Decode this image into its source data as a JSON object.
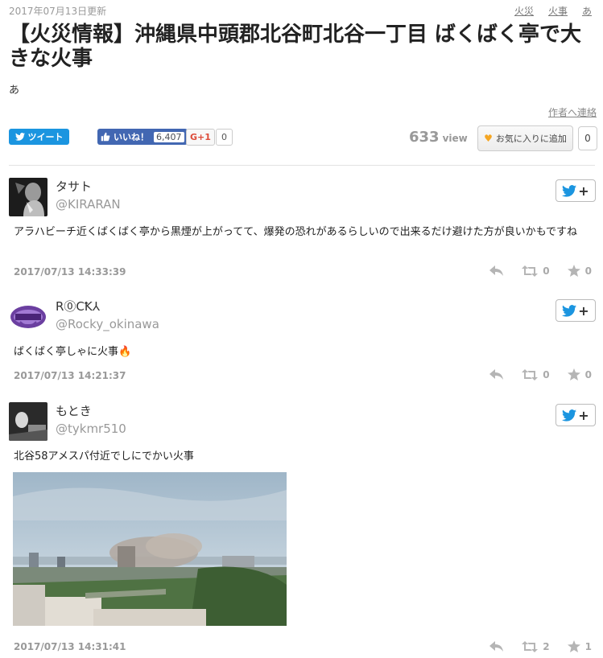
{
  "header": {
    "updated": "2017年07月13日更新",
    "tags": [
      "火災",
      "火事",
      "あ"
    ],
    "title": "【火災情報】沖縄県中頭郡北谷町北谷一丁目 ばくばく亭で大きな火事",
    "description": "あ",
    "contact_link": "作者へ連絡"
  },
  "share": {
    "tweet_label": "ツイート",
    "like_label": "いいね！",
    "like_count": "6,407",
    "gplus_label": "G+1",
    "gplus_count": "0",
    "views": "633",
    "views_unit": "view",
    "favorite_label": "お気に入りに追加",
    "favorite_count": "0"
  },
  "tweets": [
    {
      "name": "タサト",
      "handle": "@KIRARAN",
      "text": "アラハビーチ近くばくばく亭から黒煙が上がってて、爆発の恐れがあるらしいので出来るだけ避けた方が良いかもですね",
      "date": "2017/07/13 14:33:39",
      "retweets": "0",
      "likes": "0"
    },
    {
      "name": "R⓪CꝀ⅄",
      "handle": "@Rocky_okinawa",
      "text": "ばくばく亭しゃに火事🔥",
      "date": "2017/07/13 14:21:37",
      "retweets": "0",
      "likes": "0"
    },
    {
      "name": "もとき",
      "handle": "@tykmr510",
      "text": "北谷58アメスパ付近でしにでかい火事",
      "date": "2017/07/13 14:31:41",
      "retweets": "2",
      "likes": "1"
    }
  ],
  "colors": {
    "twitter": "#1b95e0",
    "facebook": "#4267b2",
    "favorite_heart": "#f5a623"
  },
  "icons": {
    "follow": "twitter-bird-icon",
    "reply": "reply-icon",
    "retweet": "retweet-icon",
    "like": "star-icon"
  }
}
